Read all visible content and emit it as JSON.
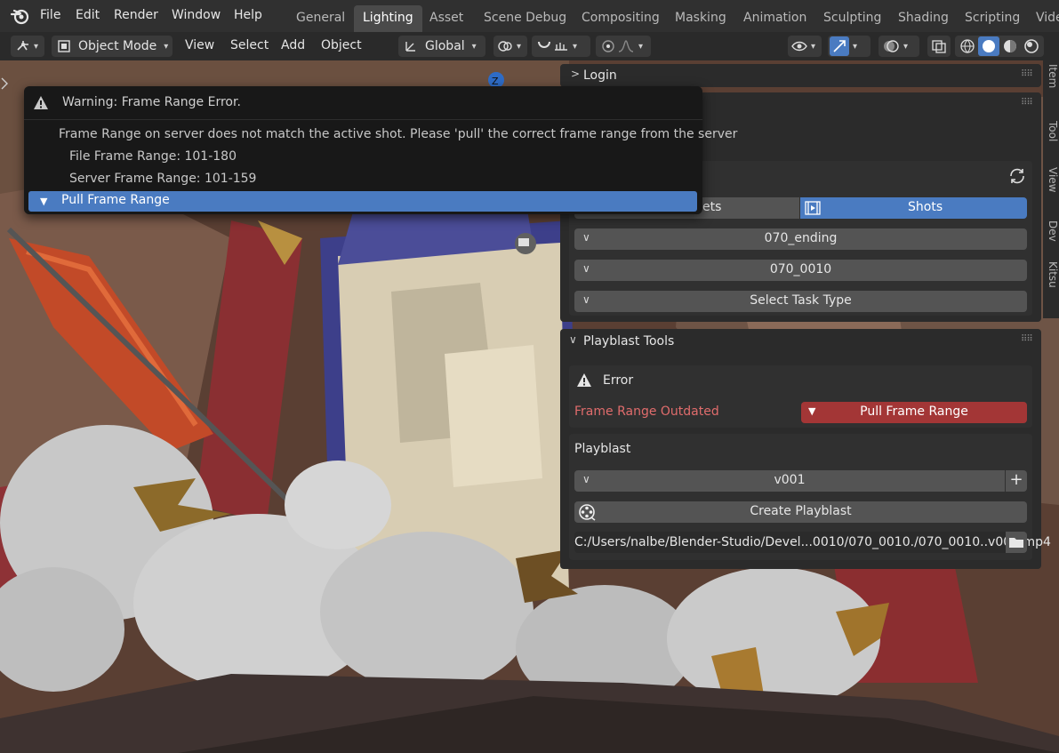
{
  "menubar": {
    "items": [
      "File",
      "Edit",
      "Render",
      "Window",
      "Help"
    ],
    "workspaces": [
      "General",
      "Lighting",
      "Asset",
      "Scene Debug",
      "Compositing",
      "Masking",
      "Animation",
      "Sculpting",
      "Shading",
      "Scripting",
      "Vide"
    ],
    "active_workspace": "Lighting"
  },
  "viewport_header": {
    "mode": "Object Mode",
    "menus": [
      "View",
      "Select",
      "Add",
      "Object"
    ],
    "transform_orientation": "Global"
  },
  "gizmo": {
    "axis_label": "Z"
  },
  "warning": {
    "title": "Warning: Frame Range Error.",
    "lines": [
      "Frame Range on server does not match the active shot. Please 'pull' the correct frame range from the server",
      "File Frame Range: 101-180",
      "Server Frame Range: 101-159"
    ],
    "action": "Pull Frame Range"
  },
  "login_panel": {
    "title": "Login"
  },
  "context_panel": {
    "tab_left_partial": "ets",
    "tab_right": "Shots",
    "sequence": "070_ending",
    "shot": "070_0010",
    "task_type": "Select Task Type",
    "partial_text": "s"
  },
  "playblast_tools": {
    "title": "Playblast Tools",
    "error_label": "Error",
    "outdated_label": "Frame Range Outdated",
    "pull_button": "Pull Frame Range",
    "playblast_label": "Playblast",
    "version": "v001",
    "create_button": "Create Playblast",
    "path": "C:/Users/nalbe/Blender-Studio/Devel...0010/070_0010./070_0010..v001.mp4"
  },
  "side_tabs": [
    "Item",
    "Tool",
    "View",
    "Dev",
    "Kitsu"
  ],
  "colors": {
    "accent_blue": "#4a7bc1",
    "error_red": "#a33636",
    "error_text": "#e06c6c"
  }
}
